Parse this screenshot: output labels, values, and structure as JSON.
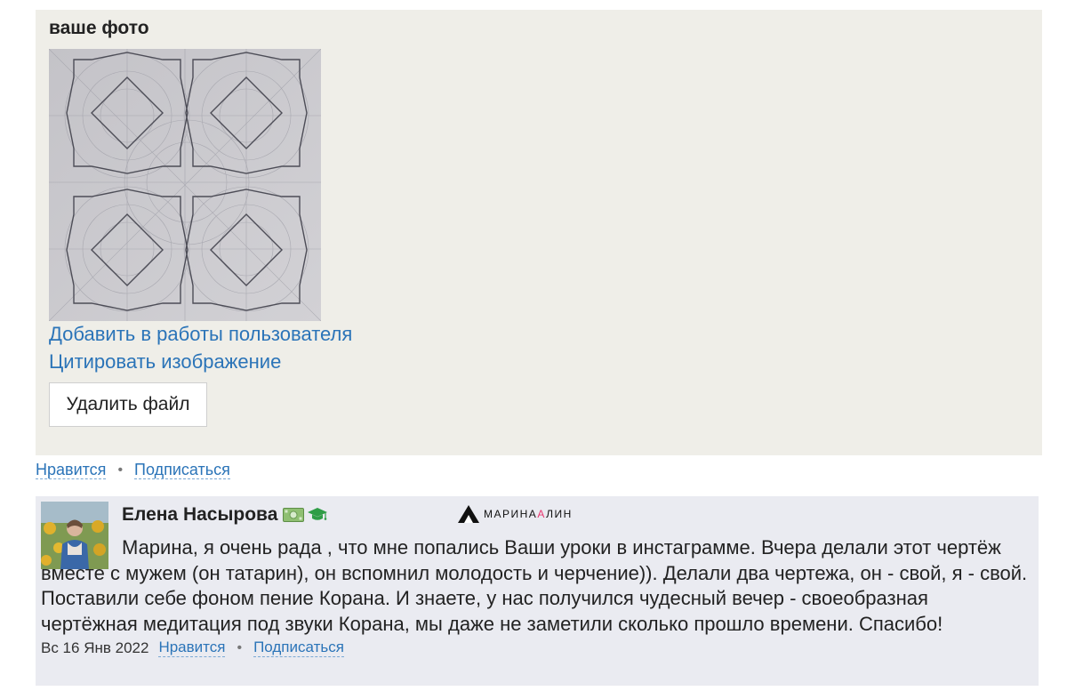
{
  "photo_block": {
    "title": "ваше фото",
    "image_alt": "geometric star pattern drawing",
    "add_to_works_link": "Добавить в работы пользователя",
    "cite_image_link": "Цитировать изображение",
    "delete_button": "Удалить файл"
  },
  "photo_actions": {
    "like": "Нравится",
    "subscribe": "Подписаться"
  },
  "comment": {
    "author": "Елена Насырова",
    "badges": [
      "money-badge-icon",
      "graduation-cap-icon"
    ],
    "brand": "МАРИНААЛИН",
    "brand_part1": "МАРИНА",
    "brand_part2": "А",
    "brand_part3": "ЛИН",
    "text": "Марина, я очень рада , что мне попались Ваши уроки в инстаграмме. Вчера делали этот чертёж вместе с мужем (он татарин), он вспомнил молодость и черчение)). Делали два чертежа, он - свой, я - свой. Поставили себе фоном пение Корана. И знаете, у нас получился чудесный вечер - своеобразная чертёжная медитация под звуки Корана, мы даже не заметили сколько прошло времени. Спасибо!",
    "date": "Вс 16 Янв 2022",
    "like": "Нравится",
    "subscribe": "Подписаться"
  },
  "colors": {
    "link": "#2b74b8",
    "panel_bg": "#efeee8",
    "comment_bg": "#eaebf1",
    "brand_accent": "#e8356f"
  }
}
